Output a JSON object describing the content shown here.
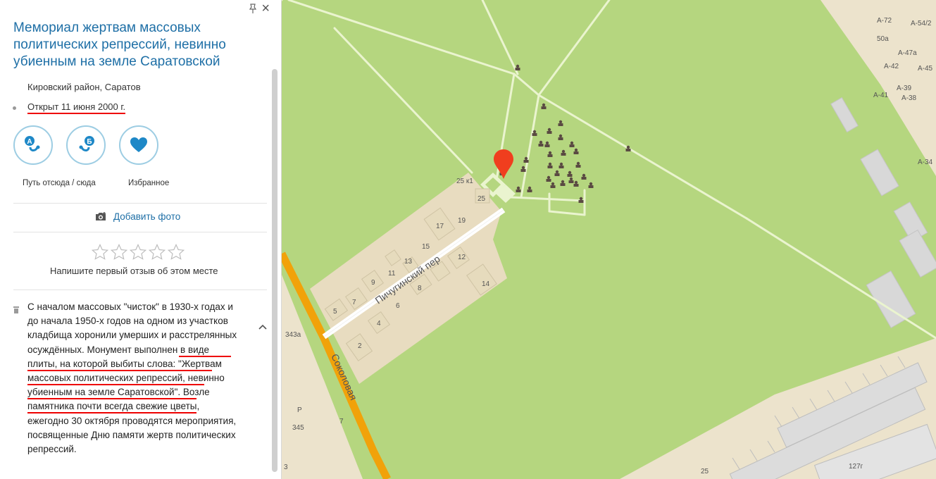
{
  "place": {
    "title": "Мемориал жертвам массовых политических репрессий, невинно убиенным на земле Саратовской",
    "address": "Кировский район, Саратов",
    "opened": "Открыт 11 июня 2000 г."
  },
  "actions": {
    "route_label": "Путь отсюда / сюда",
    "favorite_label": "Избранное",
    "route_from_letter": "А",
    "route_to_letter": "Б"
  },
  "add_photo": {
    "label": "Добавить фото"
  },
  "review": {
    "prompt": "Напишите первый отзыв об этом месте",
    "rating": 0,
    "max": 5
  },
  "description": {
    "part1": "С началом массовых \"чисток\" в 1930-х годах и до начала 1950-х годов на одном из участков кладбища хоронили умерших и расстрелянных осуждённых. ",
    "part2": "Монумент выполнен в виде плиты, на которой выбиты слова: \"Жертвам массовых политических репрессий, невинно убиенным на земле Саратовской",
    "part3": "\". Возле памятника почти всегда свежие цветы, ежегодно 30 октября проводятся мероприятия, посвященные Дню памяти жертв политических репрессий."
  },
  "map": {
    "street_labels": [
      "Пичугинский пер",
      "Соколовая"
    ],
    "building_labels": [
      "25 к1",
      "25",
      "17",
      "19",
      "15",
      "13",
      "12",
      "11",
      "9",
      "7",
      "8",
      "6",
      "5",
      "4",
      "2",
      "14",
      "343а",
      "345",
      "3",
      "7",
      "127г",
      "25",
      "А-72",
      "А-54/2",
      "50а",
      "А-47а",
      "А-42",
      "А-45",
      "А-41",
      "А-39",
      "А-38",
      "А-34",
      "Р"
    ],
    "colors": {
      "park": "#b5d67f",
      "urban": "#ece3cc",
      "road": "#f1a20a",
      "path": "#eaf4cf",
      "marker": "#f03e1e"
    }
  }
}
